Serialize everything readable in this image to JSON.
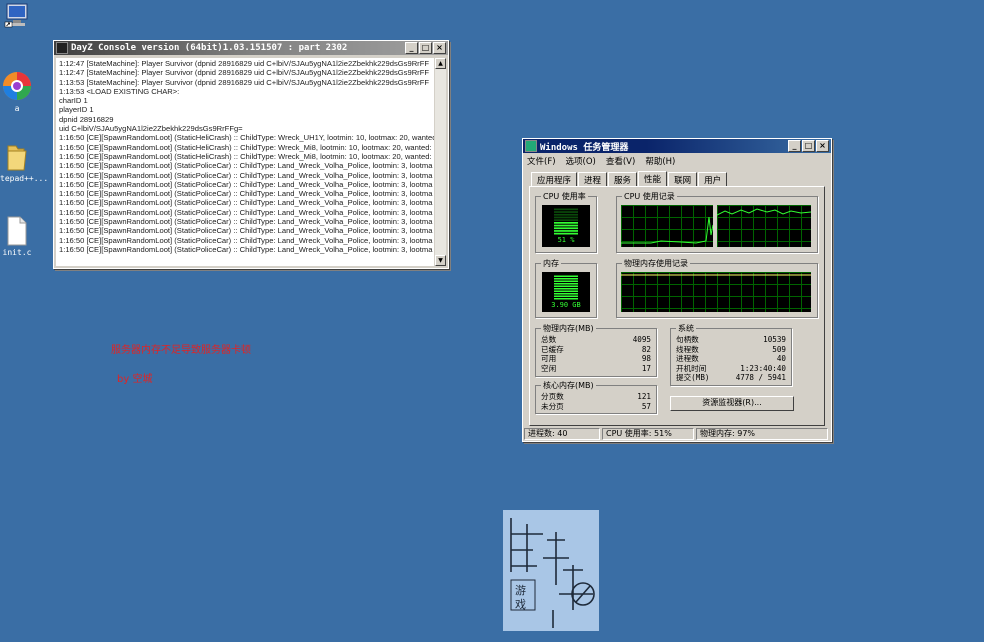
{
  "desktop": {
    "icons": [
      {
        "label": "",
        "name": "computer"
      },
      {
        "label": "a",
        "name": "browser"
      },
      {
        "label": "tepad++...",
        "name": "folder"
      },
      {
        "label": "init.c",
        "name": "file"
      }
    ]
  },
  "console": {
    "title": "DayZ Console version (64bit)1.03.151507 : part 2302",
    "lines": [
      "1:12:47 [StateMachine]: Player Survivor (dpnid 28916829 uid C+lbiV/SJAu5ygNA1l2ie2Zbekhk229dsGs9RrFF",
      "1:12:47 [StateMachine]: Player Survivor (dpnid 28916829 uid C+lbiV/SJAu5ygNA1l2ie2Zbekhk229dsGs9RrFF",
      "1:13:53 [StateMachine]: Player Survivor (dpnid 28916829 uid C+lbiV/SJAu5ygNA1l2ie2Zbekhk229dsGs9RrFF",
      "1:13:53 <LOAD EXISTING CHAR>:",
      "    charID 1",
      "    playerID 1",
      "    dpnid 28916829",
      "    uid C+lbiV/SJAu5ygNA1l2ie2Zbekhk229dsGs9RrFFg=",
      "1:16:50 [CE][SpawnRandomLoot] (StaticHeliCrash) :: ChildType: Wreck_UH1Y, lootmin: 10, lootmax: 20, wanted",
      "1:16:50 [CE][SpawnRandomLoot] (StaticHeliCrash) :: ChildType: Wreck_Mi8, lootmin: 10, lootmax: 20, wanted:",
      "1:16:50 [CE][SpawnRandomLoot] (StaticHeliCrash) :: ChildType: Wreck_Mi8, lootmin: 10, lootmax: 20, wanted:",
      "1:16:50 [CE][SpawnRandomLoot] (StaticPoliceCar) :: ChildType: Land_Wreck_Volha_Police, lootmin: 3, lootma",
      "1:16:50 [CE][SpawnRandomLoot] (StaticPoliceCar) :: ChildType: Land_Wreck_Volha_Police, lootmin: 3, lootma",
      "1:16:50 [CE][SpawnRandomLoot] (StaticPoliceCar) :: ChildType: Land_Wreck_Volha_Police, lootmin: 3, lootma",
      "1:16:50 [CE][SpawnRandomLoot] (StaticPoliceCar) :: ChildType: Land_Wreck_Volha_Police, lootmin: 3, lootma",
      "1:16:50 [CE][SpawnRandomLoot] (StaticPoliceCar) :: ChildType: Land_Wreck_Volha_Police, lootmin: 3, lootma",
      "1:16:50 [CE][SpawnRandomLoot] (StaticPoliceCar) :: ChildType: Land_Wreck_Volha_Police, lootmin: 3, lootma",
      "1:16:50 [CE][SpawnRandomLoot] (StaticPoliceCar) :: ChildType: Land_Wreck_Volha_Police, lootmin: 3, lootma",
      "1:16:50 [CE][SpawnRandomLoot] (StaticPoliceCar) :: ChildType: Land_Wreck_Volha_Police, lootmin: 3, lootma",
      "1:16:50 [CE][SpawnRandomLoot] (StaticPoliceCar) :: ChildType: Land_Wreck_Volha_Police, lootmin: 3, lootma",
      "1:16:50 [CE][SpawnRandomLoot] (StaticPoliceCar) :: ChildType: Land_Wreck_Volha_Police, lootmin: 3, lootma"
    ]
  },
  "taskmgr": {
    "title": "Windows 任务管理器",
    "menu": [
      "文件(F)",
      "选项(O)",
      "查看(V)",
      "帮助(H)"
    ],
    "tabs": [
      "应用程序",
      "进程",
      "服务",
      "性能",
      "联网",
      "用户"
    ],
    "active_tab": "性能",
    "cpu_usage_label": "CPU 使用率",
    "cpu_usage_value": "51 %",
    "cpu_usage_pct": 51,
    "cpu_history_label": "CPU 使用记录",
    "mem_label": "内存",
    "mem_value": "3.90 GB",
    "mem_pct": 97,
    "mem_history_label": "物理内存使用记录",
    "physical_memory": {
      "label": "物理内存(MB)",
      "rows": [
        {
          "k": "总数",
          "v": "4095"
        },
        {
          "k": "已缓存",
          "v": "82"
        },
        {
          "k": "可用",
          "v": "98"
        },
        {
          "k": "空闲",
          "v": "17"
        }
      ]
    },
    "system": {
      "label": "系统",
      "rows": [
        {
          "k": "句柄数",
          "v": "10539"
        },
        {
          "k": "线程数",
          "v": "509"
        },
        {
          "k": "进程数",
          "v": "40"
        },
        {
          "k": "开机时间",
          "v": "1:23:40:40"
        },
        {
          "k": "提交(MB)",
          "v": "4778 / 5941"
        }
      ]
    },
    "kernel_memory": {
      "label": "核心内存(MB)",
      "rows": [
        {
          "k": "分页数",
          "v": "121"
        },
        {
          "k": "未分页",
          "v": "57"
        }
      ]
    },
    "resource_monitor_button": "资源监视器(R)...",
    "status": {
      "processes": "进程数: 40",
      "cpu": "CPU 使用率: 51%",
      "memory": "物理内存: 97%"
    }
  },
  "desktop_notes": {
    "line1": "服务器内存不足导致服务器卡顿",
    "line2": "by 空城"
  },
  "colors": {
    "desktop_bg": "#3a6ea5",
    "graph_line": "#33ff33",
    "note_red": "#e02424"
  }
}
